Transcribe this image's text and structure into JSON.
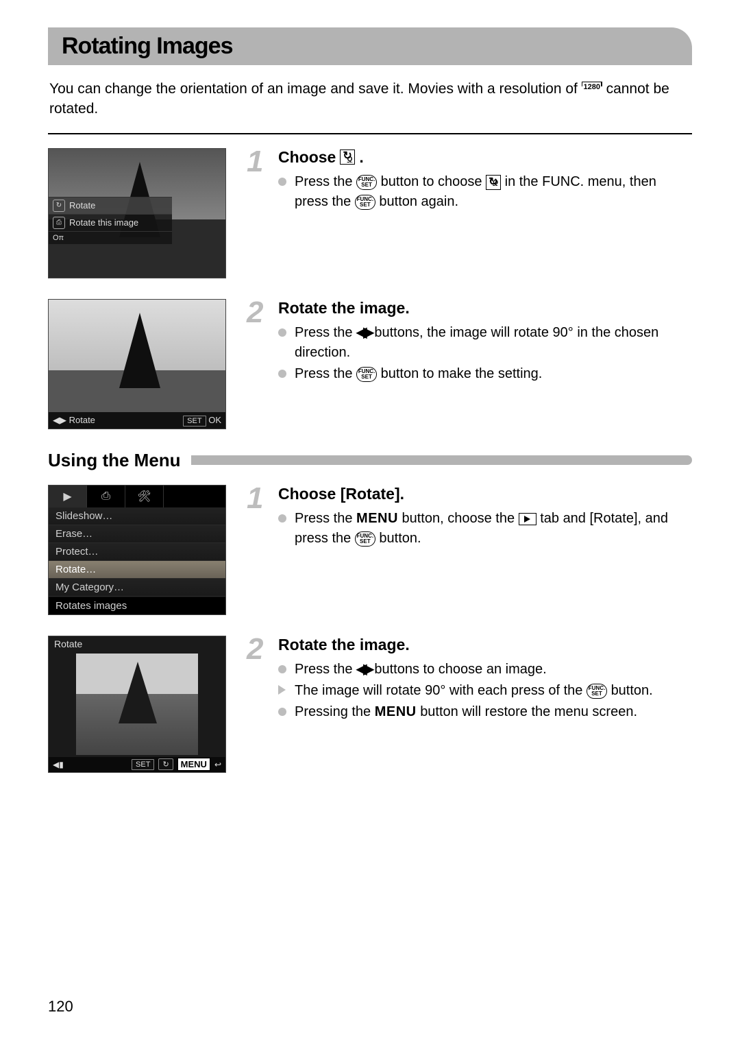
{
  "page_number": "120",
  "title": "Rotating Images",
  "intro_pre": "You can change the orientation of an image and save it. Movies with a resolution of ",
  "intro_res": "1280",
  "intro_post": " cannot be rotated.",
  "func_screenshot": {
    "rotate_label": "Rotate",
    "desc_label": "Rotate this image",
    "icon_name": "rotate-icon"
  },
  "rotate_preview": {
    "footer_left": "◀▶ Rotate",
    "set_label": "SET",
    "ok_label": "OK"
  },
  "sectionA": {
    "step1": {
      "num": "1",
      "title_pre": "Choose ",
      "title_post": ".",
      "line1_pre": "Press the ",
      "line1_mid": " button to choose ",
      "line1_mid2": " in the FUNC. menu, then press the ",
      "line1_post": " button again."
    },
    "step2": {
      "num": "2",
      "title": "Rotate the image.",
      "line1_pre": "Press the ",
      "line1_post": " buttons, the image will rotate 90° in the chosen direction.",
      "line2_pre": "Press the ",
      "line2_post": " button to make the setting."
    }
  },
  "subhead": "Using the Menu",
  "menu_screenshot": {
    "tabs": [
      "▶",
      "⎙",
      "🛠"
    ],
    "items": [
      "Slideshow…",
      "Erase…",
      "Protect…",
      "Rotate…",
      "My Category…"
    ],
    "selected_index": 3,
    "status": "Rotates images"
  },
  "rotate_screenshot": {
    "header": "Rotate",
    "left_corner": "◀▮",
    "set_label": "SET",
    "rotate_box": "↻",
    "menu_label": "MENU",
    "back": "↩"
  },
  "sectionB": {
    "step1": {
      "num": "1",
      "title": "Choose [Rotate].",
      "line1_pre": "Press the ",
      "menu_word": "MENU",
      "line1_mid": " button, choose the ",
      "line1_mid2": " tab and [Rotate], and press the ",
      "line1_post": " button."
    },
    "step2": {
      "num": "2",
      "title": "Rotate the image.",
      "line1_pre": "Press the ",
      "line1_post": " buttons to choose an image.",
      "line2_pre": "The image will rotate 90° with each press of the ",
      "line2_post": " button.",
      "line3_pre": "Pressing the ",
      "menu_word": "MENU",
      "line3_post": " button will restore the menu screen."
    }
  }
}
